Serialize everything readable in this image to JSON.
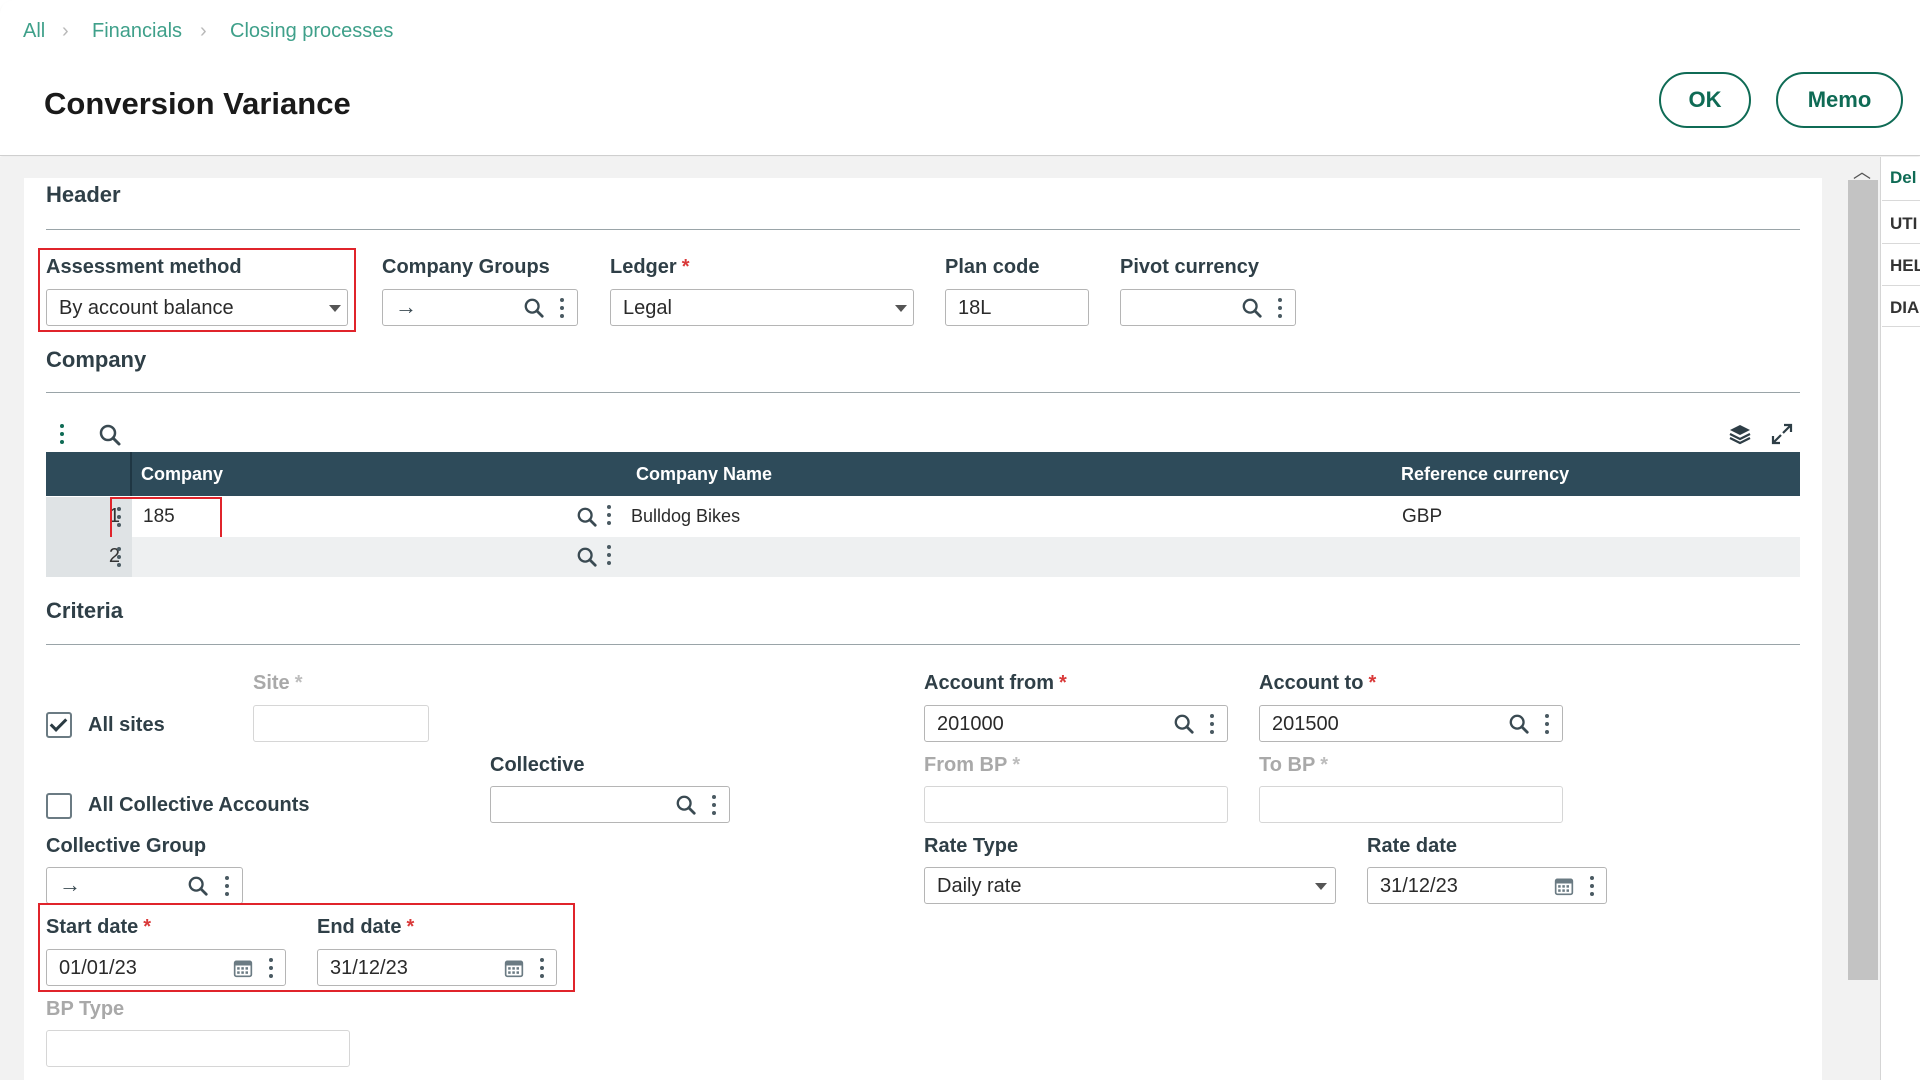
{
  "breadcrumb": {
    "items": [
      "All",
      "Financials",
      "Closing processes"
    ]
  },
  "page": {
    "title": "Conversion Variance"
  },
  "actions": {
    "ok_label": "OK",
    "memo_label": "Memo"
  },
  "right_panel": {
    "items": [
      "Del",
      "UTI",
      "HEL",
      "DIA"
    ]
  },
  "header_section": {
    "title": "Header",
    "assessment_method": {
      "label": "Assessment method",
      "value": "By account balance"
    },
    "company_groups": {
      "label": "Company Groups",
      "value": ""
    },
    "ledger": {
      "label": "Ledger",
      "value": "Legal",
      "required_mark": "*"
    },
    "plan_code": {
      "label": "Plan code",
      "value": "18L"
    },
    "pivot_currency": {
      "label": "Pivot currency",
      "value": ""
    }
  },
  "company_section": {
    "title": "Company",
    "columns": [
      "Company",
      "Company Name",
      "Reference currency"
    ],
    "rows": [
      {
        "num": "1",
        "company": "185",
        "company_name": "Bulldog Bikes",
        "reference_currency": "GBP"
      },
      {
        "num": "2",
        "company": "",
        "company_name": "",
        "reference_currency": ""
      }
    ]
  },
  "criteria_section": {
    "title": "Criteria",
    "site": {
      "label": "Site",
      "required_mark": "*",
      "value": ""
    },
    "all_sites": {
      "label": "All sites",
      "checked": true
    },
    "collective": {
      "label": "Collective",
      "value": ""
    },
    "all_collective_accounts": {
      "label": "All Collective Accounts",
      "checked": false
    },
    "collective_group": {
      "label": "Collective Group",
      "value": ""
    },
    "start_date": {
      "label": "Start date",
      "required_mark": "*",
      "value": "01/01/23"
    },
    "end_date": {
      "label": "End date",
      "required_mark": "*",
      "value": "31/12/23"
    },
    "bp_type": {
      "label": "BP Type",
      "value": ""
    },
    "account_from": {
      "label": "Account from",
      "required_mark": "*",
      "value": "201000"
    },
    "account_to": {
      "label": "Account to",
      "required_mark": "*",
      "value": "201500"
    },
    "from_bp": {
      "label": "From BP",
      "required_mark": "*",
      "value": ""
    },
    "to_bp": {
      "label": "To BP",
      "required_mark": "*",
      "value": ""
    },
    "rate_type": {
      "label": "Rate Type",
      "value": "Daily rate"
    },
    "rate_date": {
      "label": "Rate date",
      "value": "31/12/23"
    }
  },
  "icons": {
    "search": "search-icon",
    "more": "kebab-icon",
    "calendar": "calendar-icon",
    "dropdown": "chevron-down-icon",
    "arrow": "arrow-right-icon",
    "layers": "layers-icon",
    "expand": "expand-icon",
    "check": "checkmark-icon"
  },
  "colors": {
    "accent": "#0f6b55",
    "table_header": "#2e4b5a",
    "highlight": "#e0242b",
    "required": "#d93939"
  }
}
